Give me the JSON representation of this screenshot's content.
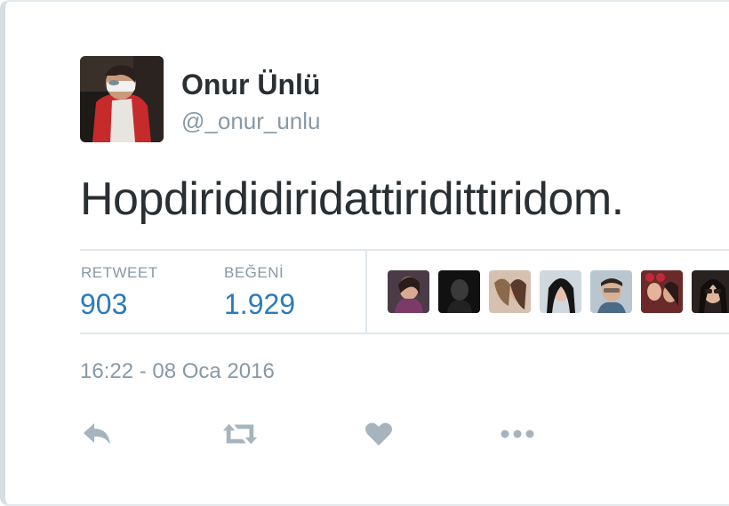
{
  "author": {
    "display_name": "Onur Ünlü",
    "handle": "@_onur_unlu"
  },
  "tweet": {
    "text": "Hopdirididiridattiridittiridom.",
    "timestamp": "16:22 - 08 Oca 2016"
  },
  "stats": {
    "retweet_label": "RETWEET",
    "retweet_count": "903",
    "like_label": "BEĞENİ",
    "like_count": "1.929"
  },
  "actions": [
    {
      "icon": "reply-icon"
    },
    {
      "icon": "retweet-icon"
    },
    {
      "icon": "heart-icon"
    },
    {
      "icon": "more-icon"
    }
  ],
  "colors": {
    "text": "#292f33",
    "muted": "#8899a6",
    "link": "#2b7bb9",
    "divider": "#e1e8ed"
  }
}
